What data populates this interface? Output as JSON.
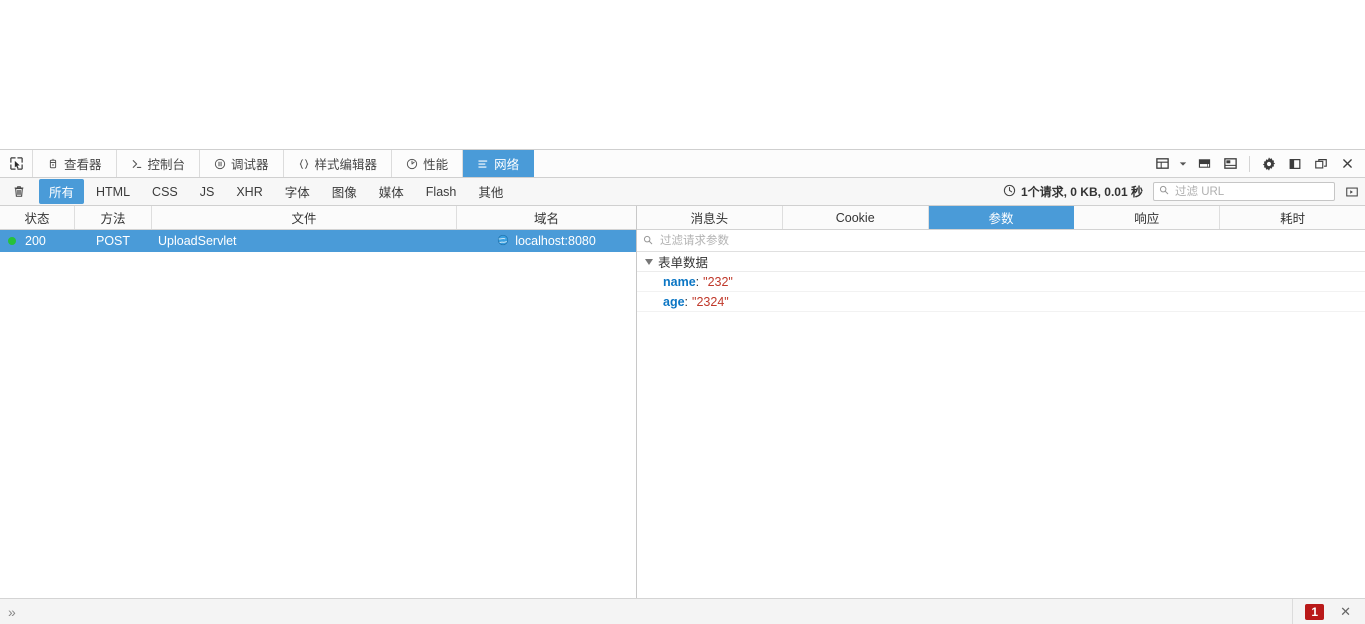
{
  "toolbar": {
    "picker_icon": "element-picker-icon",
    "tabs": [
      {
        "label": "查看器",
        "icon": "inspector-icon",
        "active": false
      },
      {
        "label": "控制台",
        "icon": "console-icon",
        "active": false
      },
      {
        "label": "调试器",
        "icon": "debugger-icon",
        "active": false
      },
      {
        "label": "样式编辑器",
        "icon": "style-editor-icon",
        "active": false
      },
      {
        "label": "性能",
        "icon": "performance-icon",
        "active": false
      },
      {
        "label": "网络",
        "icon": "network-icon",
        "active": true
      }
    ],
    "right_icons": [
      {
        "name": "responsive-design-mode-icon"
      },
      {
        "name": "chevron-down-icon"
      },
      {
        "name": "screenshot-icon"
      },
      {
        "name": "split-console-icon"
      },
      {
        "name": "settings-gear-icon"
      },
      {
        "name": "dock-side-icon"
      },
      {
        "name": "dock-separate-window-icon"
      },
      {
        "name": "close-icon"
      }
    ]
  },
  "filter_bar": {
    "clear_icon": "trash-icon",
    "buttons": [
      {
        "label": "所有",
        "active": true
      },
      {
        "label": "HTML",
        "active": false
      },
      {
        "label": "CSS",
        "active": false
      },
      {
        "label": "JS",
        "active": false
      },
      {
        "label": "XHR",
        "active": false
      },
      {
        "label": "字体",
        "active": false
      },
      {
        "label": "图像",
        "active": false
      },
      {
        "label": "媒体",
        "active": false
      },
      {
        "label": "Flash",
        "active": false
      },
      {
        "label": "其他",
        "active": false
      }
    ],
    "stats_icon": "clock-icon",
    "stats": "1个请求, 0 KB, 0.01 秒",
    "url_filter_placeholder": "过滤 URL",
    "url_filter_value": "",
    "url_filter_icon": "search-icon",
    "toggle_panel_icon": "toggle-details-panel-icon"
  },
  "requests": {
    "columns": [
      "状态",
      "方法",
      "文件",
      "域名"
    ],
    "rows": [
      {
        "status": "200",
        "status_dot_color": "#27c13a",
        "method": "POST",
        "file": "UploadServlet",
        "domain": "localhost:8080",
        "domain_icon": "globe-icon",
        "selected": true
      }
    ]
  },
  "details": {
    "tabs": [
      {
        "label": "消息头",
        "active": false
      },
      {
        "label": "Cookie",
        "active": false
      },
      {
        "label": "参数",
        "active": true
      },
      {
        "label": "响应",
        "active": false
      },
      {
        "label": "耗时",
        "active": false
      }
    ],
    "filter_placeholder": "过滤请求参数",
    "filter_value": "",
    "filter_icon": "search-icon",
    "group_label": "表单数据",
    "params": [
      {
        "key": "name",
        "value": "\"232\""
      },
      {
        "key": "age",
        "value": "\"2324\""
      }
    ]
  },
  "statusbar": {
    "expand_icon": "chevron-double-right-icon",
    "error_count": "1",
    "close_icon": "close-icon"
  },
  "colors": {
    "accent": "#4a9bd8",
    "status_ok": "#27c13a",
    "param_key": "#0b76c4",
    "param_value": "#c0392b",
    "error_badge": "#b91919"
  }
}
